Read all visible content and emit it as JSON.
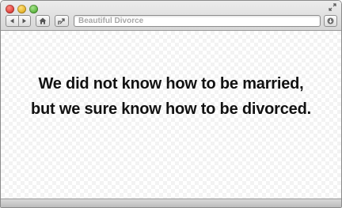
{
  "window": {
    "title": "Beautiful Divorce"
  },
  "toolbar": {
    "back_icon": "back-arrow-icon",
    "forward_icon": "forward-arrow-icon",
    "home_icon": "home-icon",
    "share_icon": "share-icon",
    "download_icon": "download-icon",
    "resize_icon": "fullscreen-icon",
    "address_text": "Beautiful Divorce"
  },
  "content": {
    "quote_line1": "We did not know how to be married,",
    "quote_line2": "but we sure know how to be divorced."
  },
  "colors": {
    "close": "#e0443e",
    "minimize": "#e6b52d",
    "zoom": "#5fb742",
    "text": "#111111"
  }
}
